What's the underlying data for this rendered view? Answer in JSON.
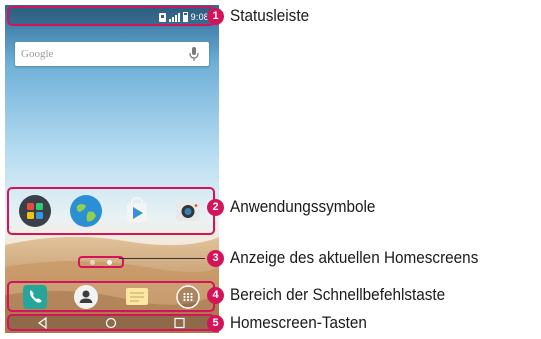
{
  "status_bar": {
    "time": "9:08"
  },
  "search_widget": {
    "logo_text": "Google"
  },
  "app_row": {
    "icons": [
      "apps-folder-icon",
      "browser-globe-icon",
      "play-store-icon",
      "camera-icon"
    ]
  },
  "dock": {
    "icons": [
      "phone-icon",
      "contacts-icon",
      "messaging-icon",
      "apps-drawer-icon"
    ]
  },
  "home_keys": {
    "icons": [
      "back-icon",
      "home-icon",
      "recent-apps-icon"
    ]
  },
  "page_indicator": {
    "pages": 2,
    "active_page": 2
  },
  "callouts": [
    {
      "number": "1",
      "label": "Statusleiste"
    },
    {
      "number": "2",
      "label": "Anwendungssymbole"
    },
    {
      "number": "3",
      "label": "Anzeige des aktuellen Homescreens"
    },
    {
      "number": "4",
      "label": "Bereich der Schnellbefehlstaste"
    },
    {
      "number": "5",
      "label": "Homescreen-Tasten"
    }
  ],
  "colors": {
    "highlight": "#d4145a",
    "badge": "#d4145a",
    "text": "#1a1a1a"
  }
}
